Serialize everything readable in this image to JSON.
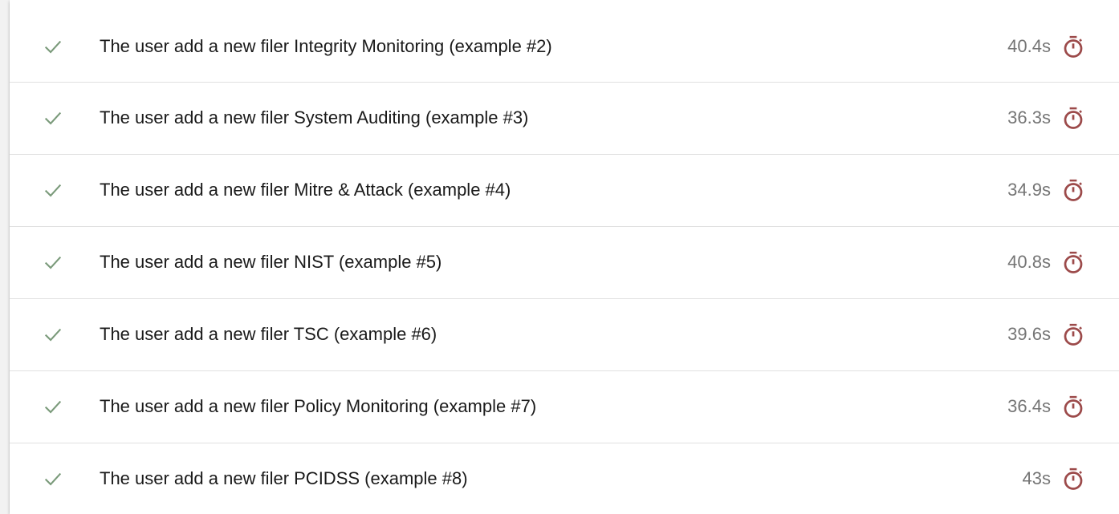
{
  "colors": {
    "check": "#7a9a7a",
    "timer": "#9c4a4a",
    "text": "#1a1a1a",
    "duration": "#757575"
  },
  "tests": [
    {
      "status_icon": "check-icon",
      "title": "The user add a new filer Integrity Monitoring (example #2)",
      "duration": "40.4s",
      "duration_icon": "stopwatch-icon"
    },
    {
      "status_icon": "check-icon",
      "title": "The user add a new filer System Auditing (example #3)",
      "duration": "36.3s",
      "duration_icon": "stopwatch-icon"
    },
    {
      "status_icon": "check-icon",
      "title": "The user add a new filer Mitre & Attack (example #4)",
      "duration": "34.9s",
      "duration_icon": "stopwatch-icon"
    },
    {
      "status_icon": "check-icon",
      "title": "The user add a new filer NIST (example #5)",
      "duration": "40.8s",
      "duration_icon": "stopwatch-icon"
    },
    {
      "status_icon": "check-icon",
      "title": "The user add a new filer TSC (example #6)",
      "duration": "39.6s",
      "duration_icon": "stopwatch-icon"
    },
    {
      "status_icon": "check-icon",
      "title": "The user add a new filer Policy Monitoring (example #7)",
      "duration": "36.4s",
      "duration_icon": "stopwatch-icon"
    },
    {
      "status_icon": "check-icon",
      "title": "The user add a new filer PCIDSS (example #8)",
      "duration": "43s",
      "duration_icon": "stopwatch-icon"
    }
  ]
}
